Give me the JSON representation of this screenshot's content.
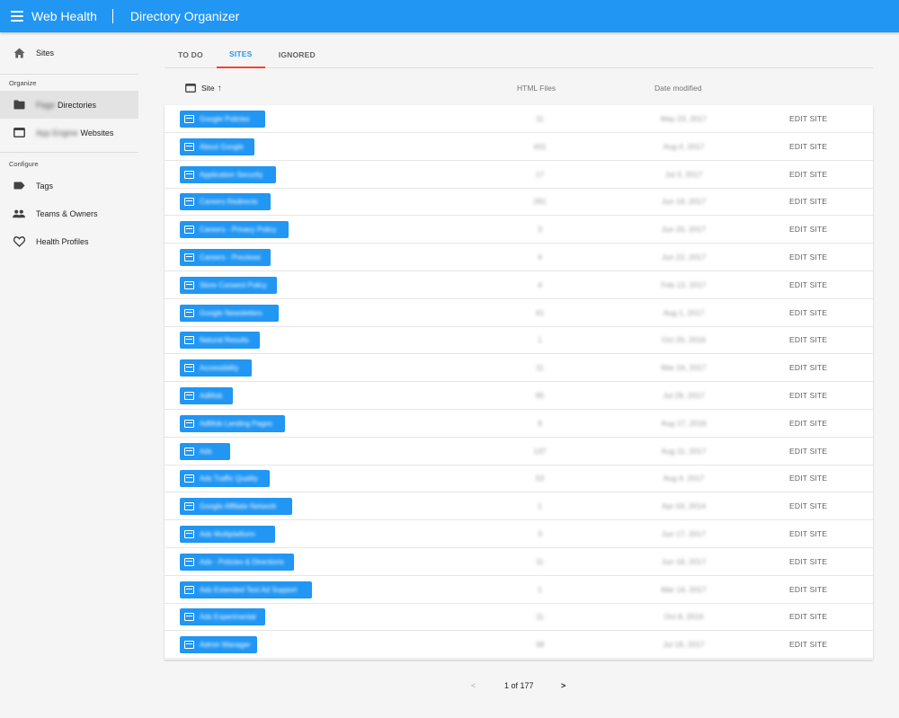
{
  "appbar": {
    "app_title": "Web Health",
    "section_title": "Directory Organizer",
    "menu_icon": "menu-icon"
  },
  "sidebar": {
    "top_item": {
      "label": "Sites",
      "icon": "home-icon"
    },
    "organize_heading": "Organize",
    "organize_items": [
      {
        "blurred": "Page",
        "label": "Directories",
        "icon": "folder-icon"
      },
      {
        "blurred": "App Engine",
        "label": "Websites",
        "icon": "web-icon"
      }
    ],
    "configure_heading": "Configure",
    "configure_items": [
      {
        "label": "Tags",
        "icon": "label-icon"
      },
      {
        "label": "Teams & Owners",
        "icon": "people-icon"
      },
      {
        "label": "Health Profiles",
        "icon": "heart-icon"
      }
    ]
  },
  "tabs": [
    {
      "label": "TO DO"
    },
    {
      "label": "SITES"
    },
    {
      "label": "IGNORED"
    }
  ],
  "table": {
    "headers": {
      "site": "Site",
      "html_files": "HTML Files",
      "date_modified": "Date modified"
    },
    "sort_indicator": "↑",
    "edit_label": "EDIT SITE",
    "rows": [
      {
        "site": "Google Policies",
        "html": "11",
        "date": "May 23, 2017"
      },
      {
        "site": "About Google",
        "html": "431",
        "date": "Aug 4, 2017"
      },
      {
        "site": "Application Security",
        "html": "17",
        "date": "Jul 3, 2017"
      },
      {
        "site": "Careers Redirects",
        "html": "291",
        "date": "Jun 19, 2017"
      },
      {
        "site": "Careers - Privacy Policy",
        "html": "3",
        "date": "Jun 20, 2017"
      },
      {
        "site": "Careers - Previews",
        "html": "4",
        "date": "Jun 22, 2017"
      },
      {
        "site": "Store Consent Policy",
        "html": "4",
        "date": "Feb 13, 2017"
      },
      {
        "site": "Google Newsletters",
        "html": "41",
        "date": "Aug 1, 2017"
      },
      {
        "site": "Natural Results",
        "html": "1",
        "date": "Oct 20, 2016"
      },
      {
        "site": "Accessibility",
        "html": "11",
        "date": "Mar 24, 2017"
      },
      {
        "site": "AdMob",
        "html": "95",
        "date": "Jul 29, 2017"
      },
      {
        "site": "AdMob Landing Pages",
        "html": "9",
        "date": "Aug 17, 2016"
      },
      {
        "site": "Ads",
        "html": "137",
        "date": "Aug 11, 2017"
      },
      {
        "site": "Ads Traffic Quality",
        "html": "53",
        "date": "Aug 4, 2017"
      },
      {
        "site": "Google Affiliate Network",
        "html": "1",
        "date": "Apr 03, 2014"
      },
      {
        "site": "Ads Multiplatform",
        "html": "3",
        "date": "Jun 17, 2017"
      },
      {
        "site": "Ads - Policies & Directions",
        "html": "11",
        "date": "Jun 18, 2017"
      },
      {
        "site": "Ads Extended Text Ad Support",
        "html": "1",
        "date": "Mar 14, 2017"
      },
      {
        "site": "Ads Experimental",
        "html": "11",
        "date": "Oct 8, 2016"
      },
      {
        "site": "Admin Manager",
        "html": "38",
        "date": "Jul 18, 2017"
      }
    ]
  },
  "pagination": {
    "prev": "<",
    "label": "1 of 177",
    "next": ">"
  },
  "colors": {
    "primary": "#2196f3",
    "tab_indicator": "#f44336"
  }
}
